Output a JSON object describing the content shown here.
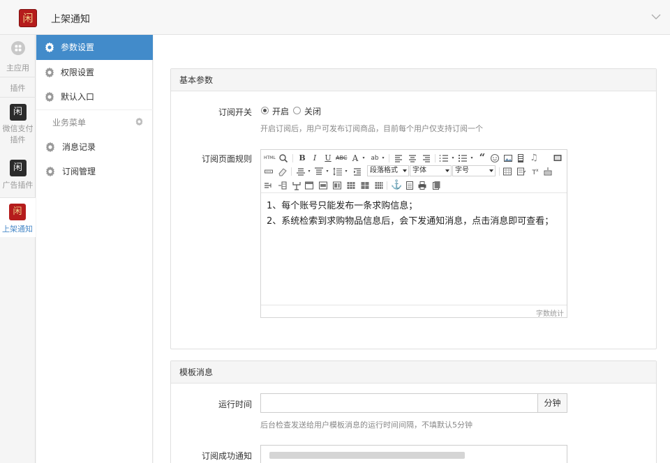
{
  "header": {
    "app_title": "上架通知",
    "logo_text": "闲"
  },
  "plugin_bar": {
    "items": [
      {
        "label": "主应用",
        "icon": "apps-icon"
      },
      {
        "label": "插件",
        "icon": ""
      },
      {
        "label": "微信支付插件",
        "label_line1": "微信支付",
        "label_line2": "插件",
        "icon": "plugin-logo"
      },
      {
        "label": "广告插件",
        "icon": "plugin-logo"
      },
      {
        "label": "上架通知",
        "icon": "plugin-logo",
        "active": true
      }
    ]
  },
  "menu": {
    "items": [
      {
        "label": "参数设置",
        "active": true
      },
      {
        "label": "权限设置"
      },
      {
        "label": "默认入口"
      }
    ],
    "group_title": "业务菜单",
    "group_items": [
      {
        "label": "消息记录"
      },
      {
        "label": "订阅管理"
      }
    ]
  },
  "basic_panel": {
    "title": "基本参数",
    "switch_label": "订阅开关",
    "switch_on": "开启",
    "switch_off": "关闭",
    "switch_value": "开启",
    "switch_help": "开启订阅后，用户可发布订阅商品，目前每个用户仅支持订阅一个",
    "rules_label": "订阅页面规则",
    "editor": {
      "paragraph_select": "段落格式",
      "font_select": "字体",
      "size_select": "字号",
      "lines": [
        "1、每个账号只能发布一条求购信息；",
        "2、系统检索到求购物品信息后，会下发通知消息，点击消息即可查看；"
      ],
      "word_count": "字数统计"
    }
  },
  "template_panel": {
    "title": "模板消息",
    "run_time_label": "运行时间",
    "run_time_value": "",
    "run_time_unit": "分钟",
    "run_time_help": "后台检查发送给用户模板消息的运行时间间隔，不填默认5分钟",
    "success_label": "订阅成功通知"
  }
}
